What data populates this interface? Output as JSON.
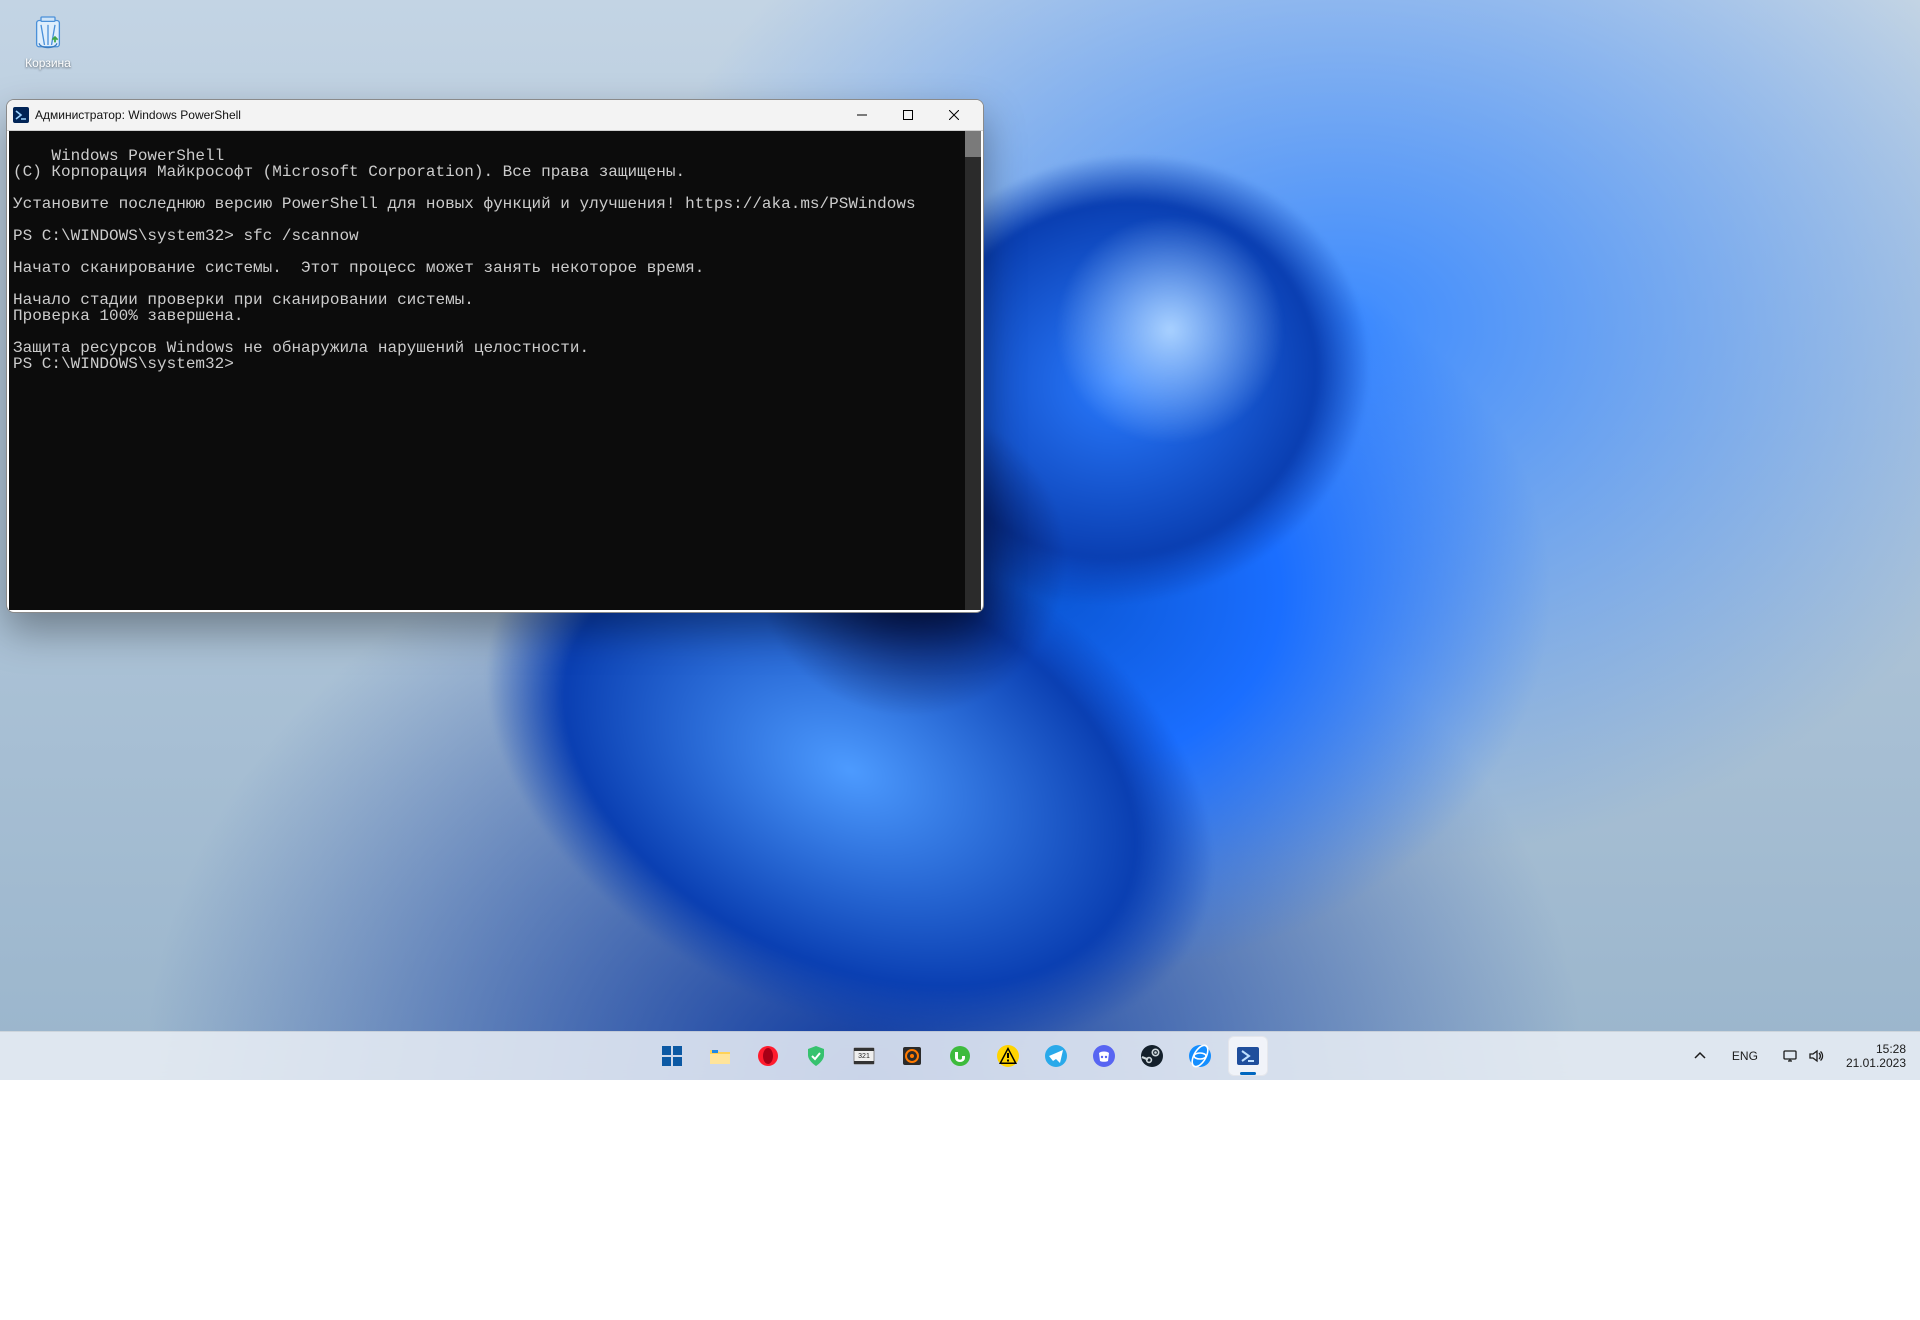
{
  "desktop": {
    "recycle_bin_label": "Корзина"
  },
  "window": {
    "title": "Администратор: Windows PowerShell",
    "console_text": "Windows PowerShell\n(C) Корпорация Майкрософт (Microsoft Corporation). Все права защищены.\n\nУстановите последнюю версию PowerShell для новых функций и улучшения! https://aka.ms/PSWindows\n\nPS C:\\WINDOWS\\system32> sfc /scannow\n\nНачато сканирование системы.  Этот процесс может занять некоторое время.\n\nНачало стадии проверки при сканировании системы.\nПроверка 100% завершена.\n\nЗащита ресурсов Windows не обнаружила нарушений целостности.\nPS C:\\WINDOWS\\system32>"
  },
  "taskbar": {
    "icons": [
      {
        "name": "start-button",
        "glyph": "win"
      },
      {
        "name": "file-explorer-icon",
        "glyph": "explorer"
      },
      {
        "name": "opera-icon",
        "glyph": "opera"
      },
      {
        "name": "security-icon",
        "glyph": "shield"
      },
      {
        "name": "media-player-classic-icon",
        "glyph": "mpc"
      },
      {
        "name": "aimp-icon",
        "glyph": "aimp"
      },
      {
        "name": "utorrent-icon",
        "glyph": "utorrent"
      },
      {
        "name": "warning-app-icon",
        "glyph": "warning"
      },
      {
        "name": "telegram-icon",
        "glyph": "telegram"
      },
      {
        "name": "discord-icon",
        "glyph": "discord"
      },
      {
        "name": "steam-icon",
        "glyph": "steam"
      },
      {
        "name": "battlenet-icon",
        "glyph": "bnet"
      },
      {
        "name": "powershell-taskbar-icon",
        "glyph": "powershell",
        "active": true
      }
    ]
  },
  "tray": {
    "language": "ENG",
    "time": "15:28",
    "date": "21.01.2023"
  }
}
